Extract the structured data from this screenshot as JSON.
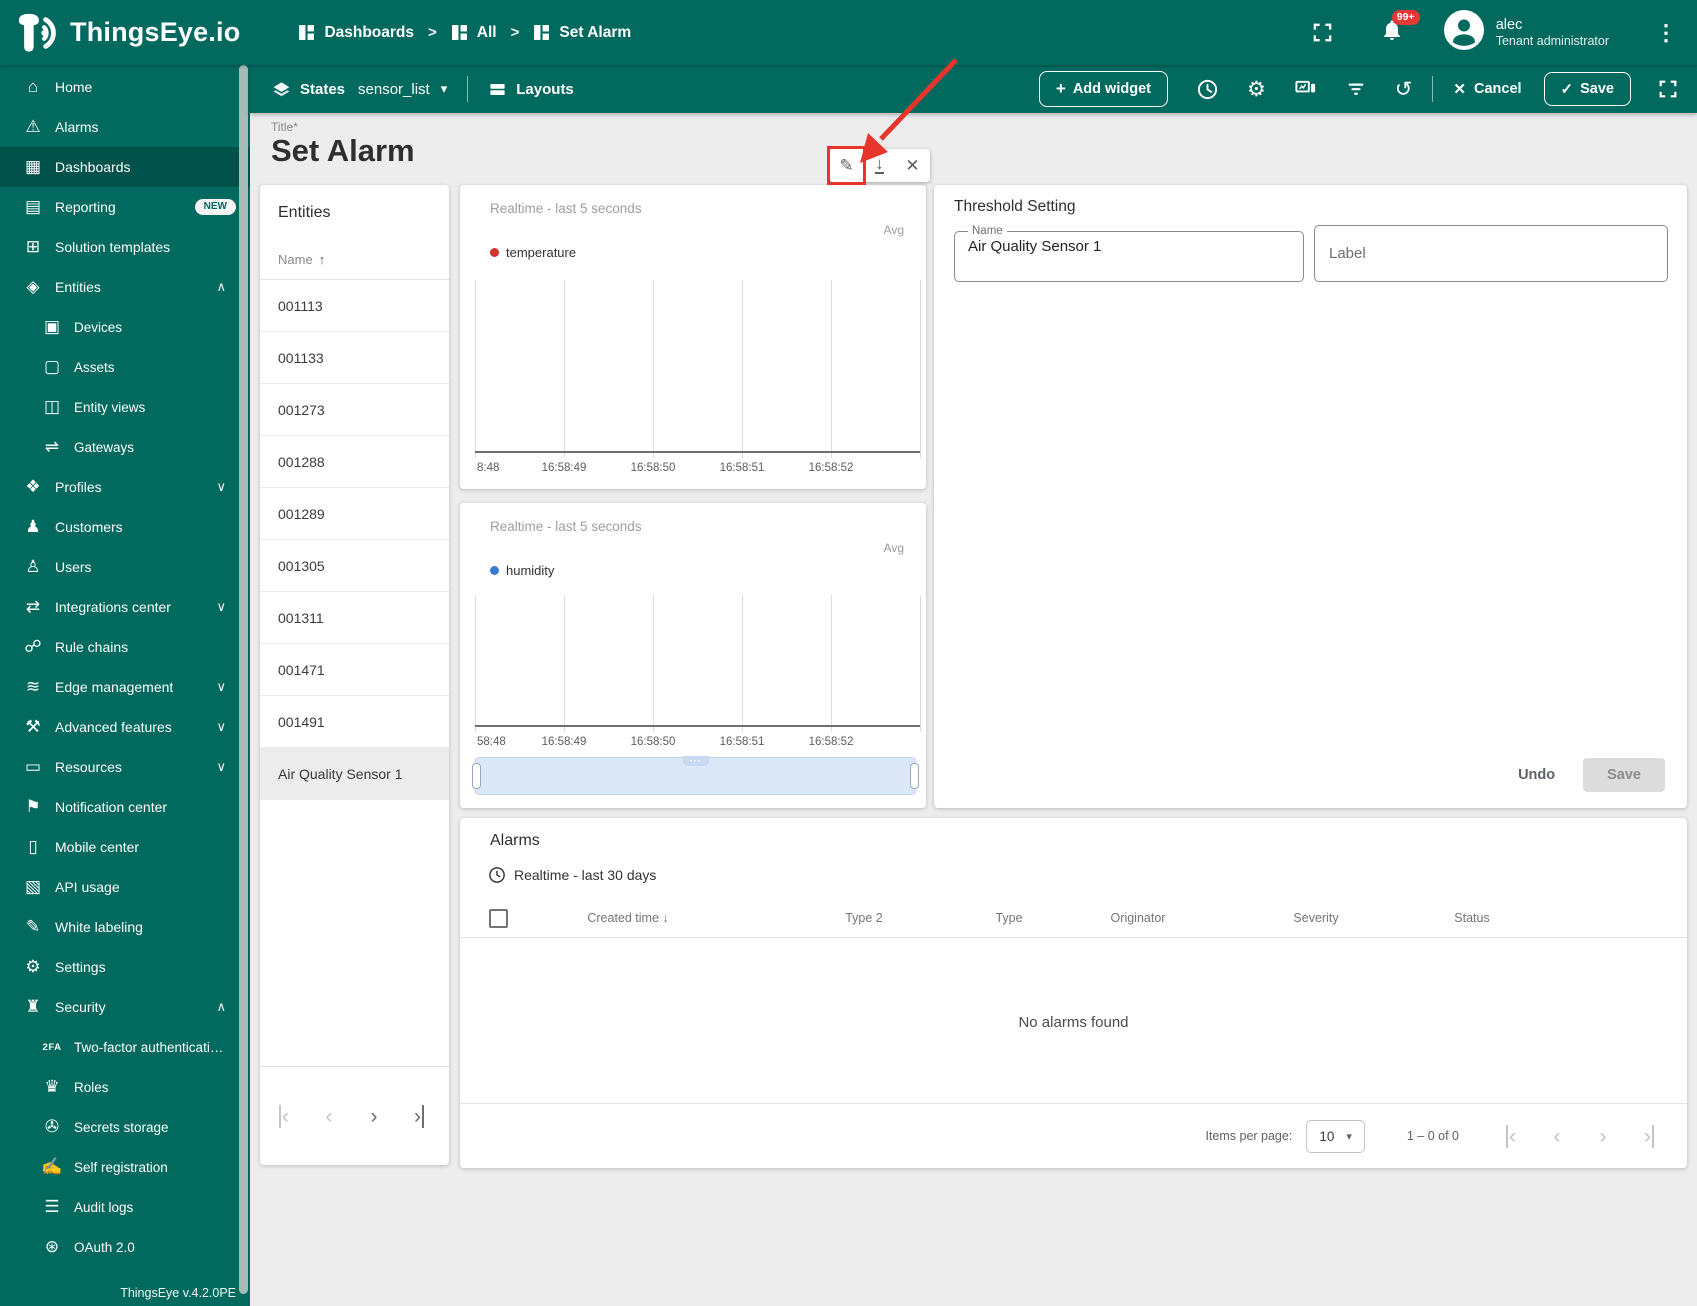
{
  "header": {
    "app_name": "ThingsEye.io",
    "breadcrumb_separator": ">",
    "breadcrumbs": [
      {
        "label": "Dashboards"
      },
      {
        "label": "All"
      },
      {
        "label": "Set Alarm"
      }
    ],
    "notification_badge": "99+",
    "user": {
      "name": "alec",
      "role": "Tenant administrator"
    }
  },
  "toolbar": {
    "states_label": "States",
    "state_value": "sensor_list",
    "layouts_label": "Layouts",
    "add_widget_label": "Add widget",
    "cancel_label": "Cancel",
    "save_label": "Save"
  },
  "glyphs": {
    "caret": "▾",
    "plus": "+",
    "check": "✓",
    "close": "✕",
    "gear": "⚙",
    "history": "↺",
    "kebab": "⋮",
    "sort_up": "↑",
    "sort_down": "↓",
    "pencil": "✎",
    "download": "↓",
    "page_first": "‹",
    "page_prev": "‹",
    "page_next": "›",
    "page_last": "›",
    "grip_dots": "⋯"
  },
  "sidebar": {
    "footer_version": "ThingsEye v.4.2.0PE",
    "items": [
      {
        "name": "home",
        "glyph": "⌂",
        "label": "Home"
      },
      {
        "name": "alarms",
        "glyph": "⚠",
        "label": "Alarms"
      },
      {
        "name": "dashboards",
        "glyph": "▦",
        "label": "Dashboards"
      },
      {
        "name": "reporting",
        "glyph": "▤",
        "label": "Reporting",
        "badge": "NEW"
      },
      {
        "name": "solution-templates",
        "glyph": "⊞",
        "label": "Solution templates"
      },
      {
        "name": "entities",
        "glyph": "◈",
        "label": "Entities",
        "chevron": "∧"
      },
      {
        "name": "devices",
        "glyph": "▣",
        "label": "Devices"
      },
      {
        "name": "assets",
        "glyph": "▢",
        "label": "Assets"
      },
      {
        "name": "entity-views",
        "glyph": "◫",
        "label": "Entity views"
      },
      {
        "name": "gateways",
        "glyph": "⇌",
        "label": "Gateways"
      },
      {
        "name": "profiles",
        "glyph": "❖",
        "label": "Profiles",
        "chevron": "∨"
      },
      {
        "name": "customers",
        "glyph": "♟",
        "label": "Customers"
      },
      {
        "name": "users",
        "glyph": "♙",
        "label": "Users"
      },
      {
        "name": "integrations-center",
        "glyph": "⇄",
        "label": "Integrations center",
        "chevron": "∨"
      },
      {
        "name": "rule-chains",
        "glyph": "☍",
        "label": "Rule chains"
      },
      {
        "name": "edge-management",
        "glyph": "≋",
        "label": "Edge management",
        "chevron": "∨"
      },
      {
        "name": "advanced-features",
        "glyph": "⚒",
        "label": "Advanced features",
        "chevron": "∨"
      },
      {
        "name": "resources",
        "glyph": "▭",
        "label": "Resources",
        "chevron": "∨"
      },
      {
        "name": "notification-center",
        "glyph": "⚑",
        "label": "Notification center"
      },
      {
        "name": "mobile-center",
        "glyph": "▯",
        "label": "Mobile center"
      },
      {
        "name": "api-usage",
        "glyph": "▧",
        "label": "API usage"
      },
      {
        "name": "white-labeling",
        "glyph": "✎",
        "label": "White labeling"
      },
      {
        "name": "settings",
        "glyph": "⚙",
        "label": "Settings"
      },
      {
        "name": "security",
        "glyph": "♜",
        "label": "Security",
        "chevron": "∧"
      },
      {
        "name": "two-factor-authentication",
        "glyph": "2FA",
        "label": "Two-factor authenticati…"
      },
      {
        "name": "roles",
        "glyph": "♛",
        "label": "Roles"
      },
      {
        "name": "secrets-storage",
        "glyph": "✇",
        "label": "Secrets storage"
      },
      {
        "name": "self-registration",
        "glyph": "✍",
        "label": "Self registration"
      },
      {
        "name": "audit-logs",
        "glyph": "☰",
        "label": "Audit logs"
      },
      {
        "name": "oauth",
        "glyph": "⊛",
        "label": "OAuth 2.0"
      }
    ]
  },
  "page": {
    "title_label": "Title*",
    "title": "Set Alarm"
  },
  "entities_panel": {
    "title": "Entities",
    "column_header": "Name",
    "rows": [
      "001113",
      "001133",
      "001273",
      "001288",
      "001289",
      "001305",
      "001311",
      "001471",
      "001491",
      "Air Quality Sensor 1"
    ],
    "selected_row": "Air Quality Sensor 1"
  },
  "charts": [
    {
      "timewindow": "Realtime - last 5 seconds",
      "aggregation": "Avg",
      "legend": "temperature",
      "legend_color": "#d0342c",
      "x_ticks": [
        "8:48",
        "16:58:49",
        "16:58:50",
        "16:58:51",
        "16:58:52"
      ]
    },
    {
      "timewindow": "Realtime - last 5 seconds",
      "aggregation": "Avg",
      "legend": "humidity",
      "legend_color": "#3a7bd5",
      "x_ticks": [
        "58:48",
        "16:58:49",
        "16:58:50",
        "16:58:51",
        "16:58:52"
      ]
    }
  ],
  "chart_data": [
    {
      "type": "line",
      "title": "Realtime - last 5 seconds",
      "series": [
        {
          "name": "temperature",
          "color": "#d0342c",
          "values": []
        }
      ],
      "x_ticks": [
        "8:48",
        "16:58:49",
        "16:58:50",
        "16:58:51",
        "16:58:52"
      ],
      "aggregation": "Avg",
      "grid": "vertical-only",
      "note": "empty chart - no data points plotted"
    },
    {
      "type": "line",
      "title": "Realtime - last 5 seconds",
      "series": [
        {
          "name": "humidity",
          "color": "#3a7bd5",
          "values": []
        }
      ],
      "x_ticks": [
        "58:48",
        "16:58:49",
        "16:58:50",
        "16:58:51",
        "16:58:52"
      ],
      "aggregation": "Avg",
      "grid": "vertical-only",
      "note": "empty chart - no data points plotted, has time range scrollbar"
    }
  ],
  "threshold_panel": {
    "title": "Threshold Setting",
    "name_field": {
      "label": "Name",
      "value": "Air Quality Sensor 1"
    },
    "label_field": {
      "placeholder": "Label"
    },
    "undo_label": "Undo",
    "save_label": "Save"
  },
  "alarms_panel": {
    "title": "Alarms",
    "timewindow": "Realtime - last 30 days",
    "columns": [
      "Created time",
      "Type 2",
      "Type",
      "Originator",
      "Severity",
      "Status"
    ],
    "empty_message": "No alarms found",
    "items_per_page_label": "Items per page:",
    "items_per_page_value": "10",
    "range_label": "1 – 0 of 0"
  },
  "annotation": {
    "color": "#e8352b",
    "target": "edit-widget-button"
  },
  "colors": {
    "brand_teal": "#02695f",
    "annotation_red": "#e8352b",
    "temperature_series": "#d0342c",
    "humidity_series": "#3a7bd5"
  }
}
